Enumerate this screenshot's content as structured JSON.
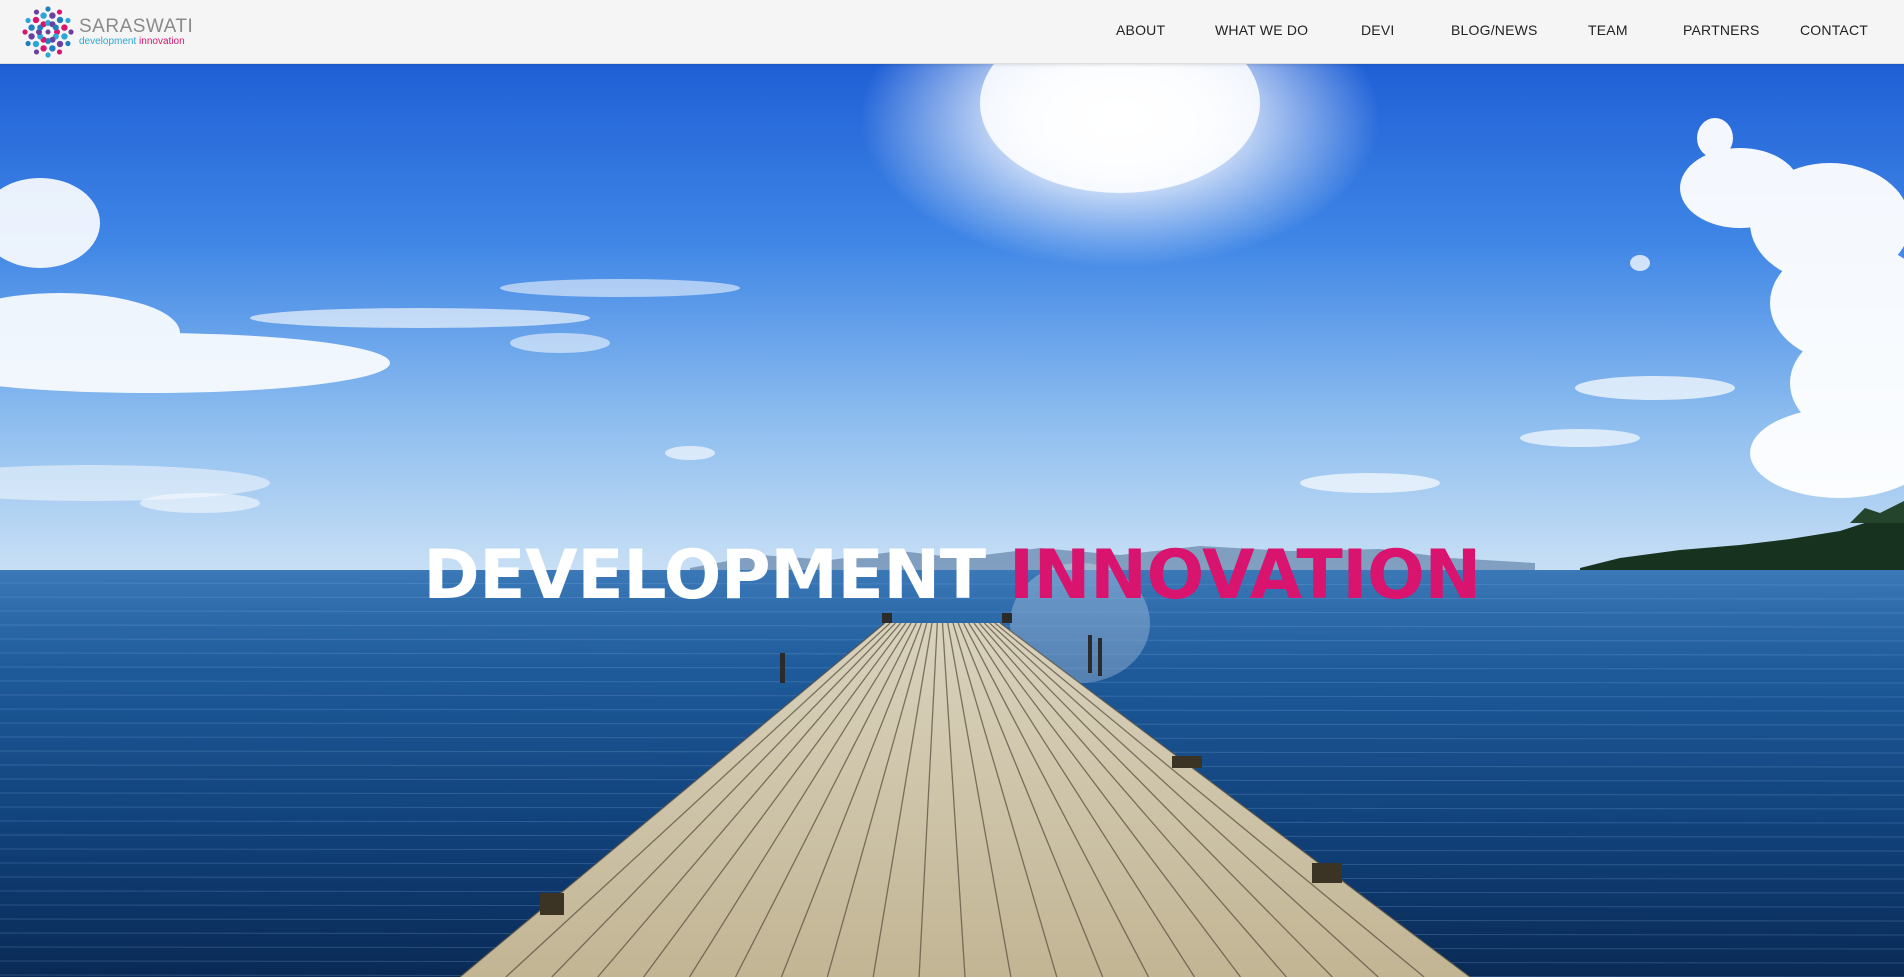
{
  "brand": {
    "name": "SARASWATI",
    "tagline_part1": "development",
    "tagline_part2": "innovation",
    "logo_colors": [
      "#d8146e",
      "#2aa7d6",
      "#6b3fa0",
      "#1f7fbf"
    ]
  },
  "nav": {
    "items": [
      {
        "label": "ABOUT"
      },
      {
        "label": "WHAT WE DO"
      },
      {
        "label": "DEVI"
      },
      {
        "label": "BLOG/NEWS"
      },
      {
        "label": "TEAM"
      },
      {
        "label": "PARTNERS"
      },
      {
        "label": "CONTACT"
      }
    ]
  },
  "hero": {
    "headline_part1": "DEVELOPMENT",
    "headline_part2": "INNOVATION",
    "accent_color": "#d8146e",
    "image": "wooden-pier-over-sea-under-blue-sky"
  }
}
